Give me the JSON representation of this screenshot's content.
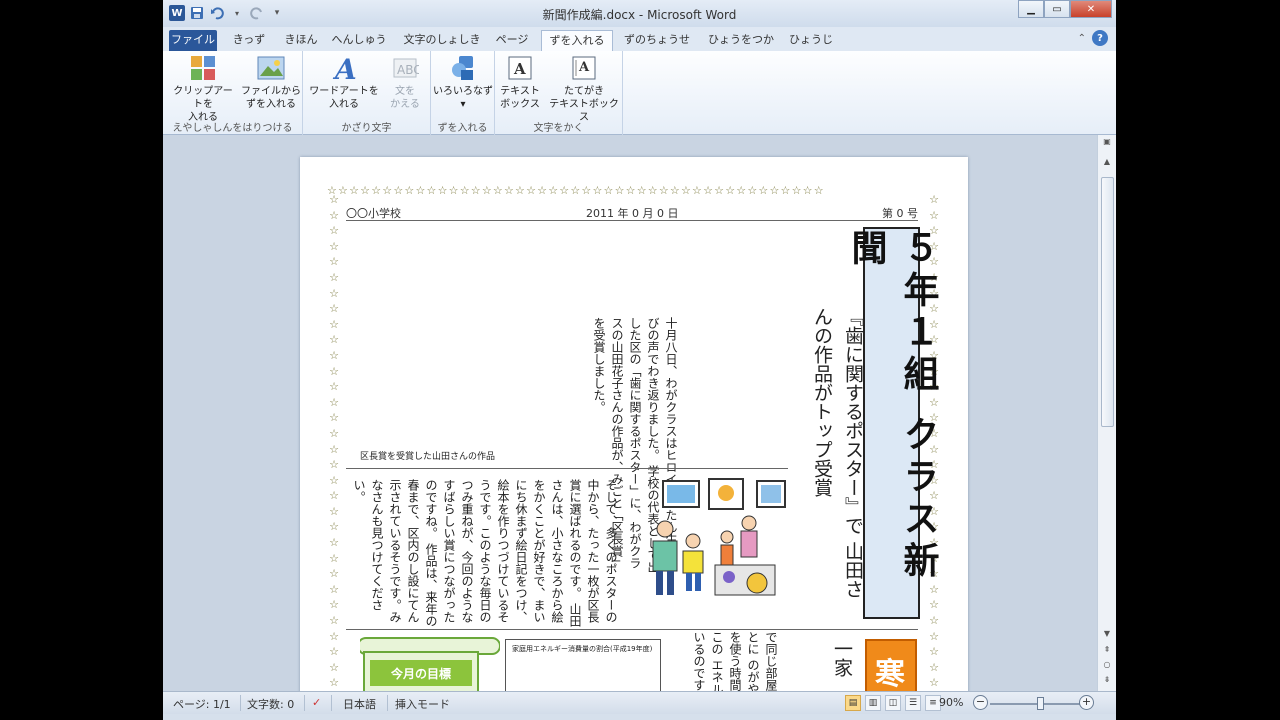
{
  "window": {
    "title": "新聞作成編.docx - Microsoft Word"
  },
  "qat": {
    "logo": "W",
    "save_icon": "save-icon",
    "undo_icon": "undo-icon",
    "redo_icon": "redo-icon"
  },
  "tabs": [
    "ファイル",
    "きっず",
    "きほん",
    "へんしゅう",
    "文字のしょしき",
    "ページ",
    "ずを入れる",
    "ずのちょうせい",
    "ひょうをつかう",
    "ひょうじ"
  ],
  "active_tab": "ずを入れる",
  "ribbon": {
    "groups": [
      {
        "label": "えやしゃしんをはりつける",
        "buttons": [
          {
            "label1": "クリップアートを",
            "label2": "入れる"
          },
          {
            "label1": "ファイルから",
            "label2": "ずを入れる"
          }
        ]
      },
      {
        "label": "かざり文字",
        "buttons": [
          {
            "label1": "ワードアートを",
            "label2": "入れる"
          },
          {
            "label1": "文を",
            "label2": "かえる"
          }
        ]
      },
      {
        "label": "ずを入れる",
        "buttons": [
          {
            "label1": "いろいろなず",
            "label2": "▾"
          }
        ]
      },
      {
        "label": "文字をかく",
        "buttons": [
          {
            "label1": "テキスト",
            "label2": "ボックス"
          },
          {
            "label1": "たてがき",
            "label2": "テキストボックス"
          }
        ]
      }
    ]
  },
  "document": {
    "school": "〇〇小学校",
    "date": "2011 年 0 月 0 日",
    "issue": "第 0 号",
    "masthead": "５年１組 クラス新聞",
    "headline": "『歯に関するポスター』で 山田さんの作品がトップ受賞",
    "body1": "十月八日、わがクラスはヒロインのたん生に喜びの声でわき返りました。 学校の代表として出した区の「歯に関するポスター」に、わがクラスの山田花子さんの作品が、みごと「区長賞」を受賞しました。",
    "caption": "区長賞を受賞した山田さんの作品",
    "body2": "そして、多くのポスターの中から、たった一枚が区長賞に選ばれるのです。 山田さんは、小さなころから絵をかくことが好きで、まいにち休まず絵日記をつけ、絵本を作りつづけているそうです。このような毎日のつみ重ねが、今回のようなすばらしい賞につながったのですね。 作品は、来年の春まで、区内のし設にてん示されているそうです。みなさんも見つけてください。",
    "goal_label": "今月の目標",
    "chart_title": "家庭用エネルギー消費量の割合(平成19年度)",
    "body3": "で同じ部屋 目ごとに のがやくそ を使う時間 実はこの エネルギー いるのです",
    "headline3": "一家",
    "cold_label": "寒い"
  },
  "status": {
    "page": "ページ: 1/1",
    "words": "文字数: 0",
    "language": "日本語",
    "mode": "挿入モード",
    "zoom": "90%",
    "zoom_level": 0.5
  },
  "colors": {
    "accent": "#2b579a",
    "masthead_bg": "#dce8f5",
    "goal_green": "#8cc43c",
    "orange": "#f08a1a"
  }
}
